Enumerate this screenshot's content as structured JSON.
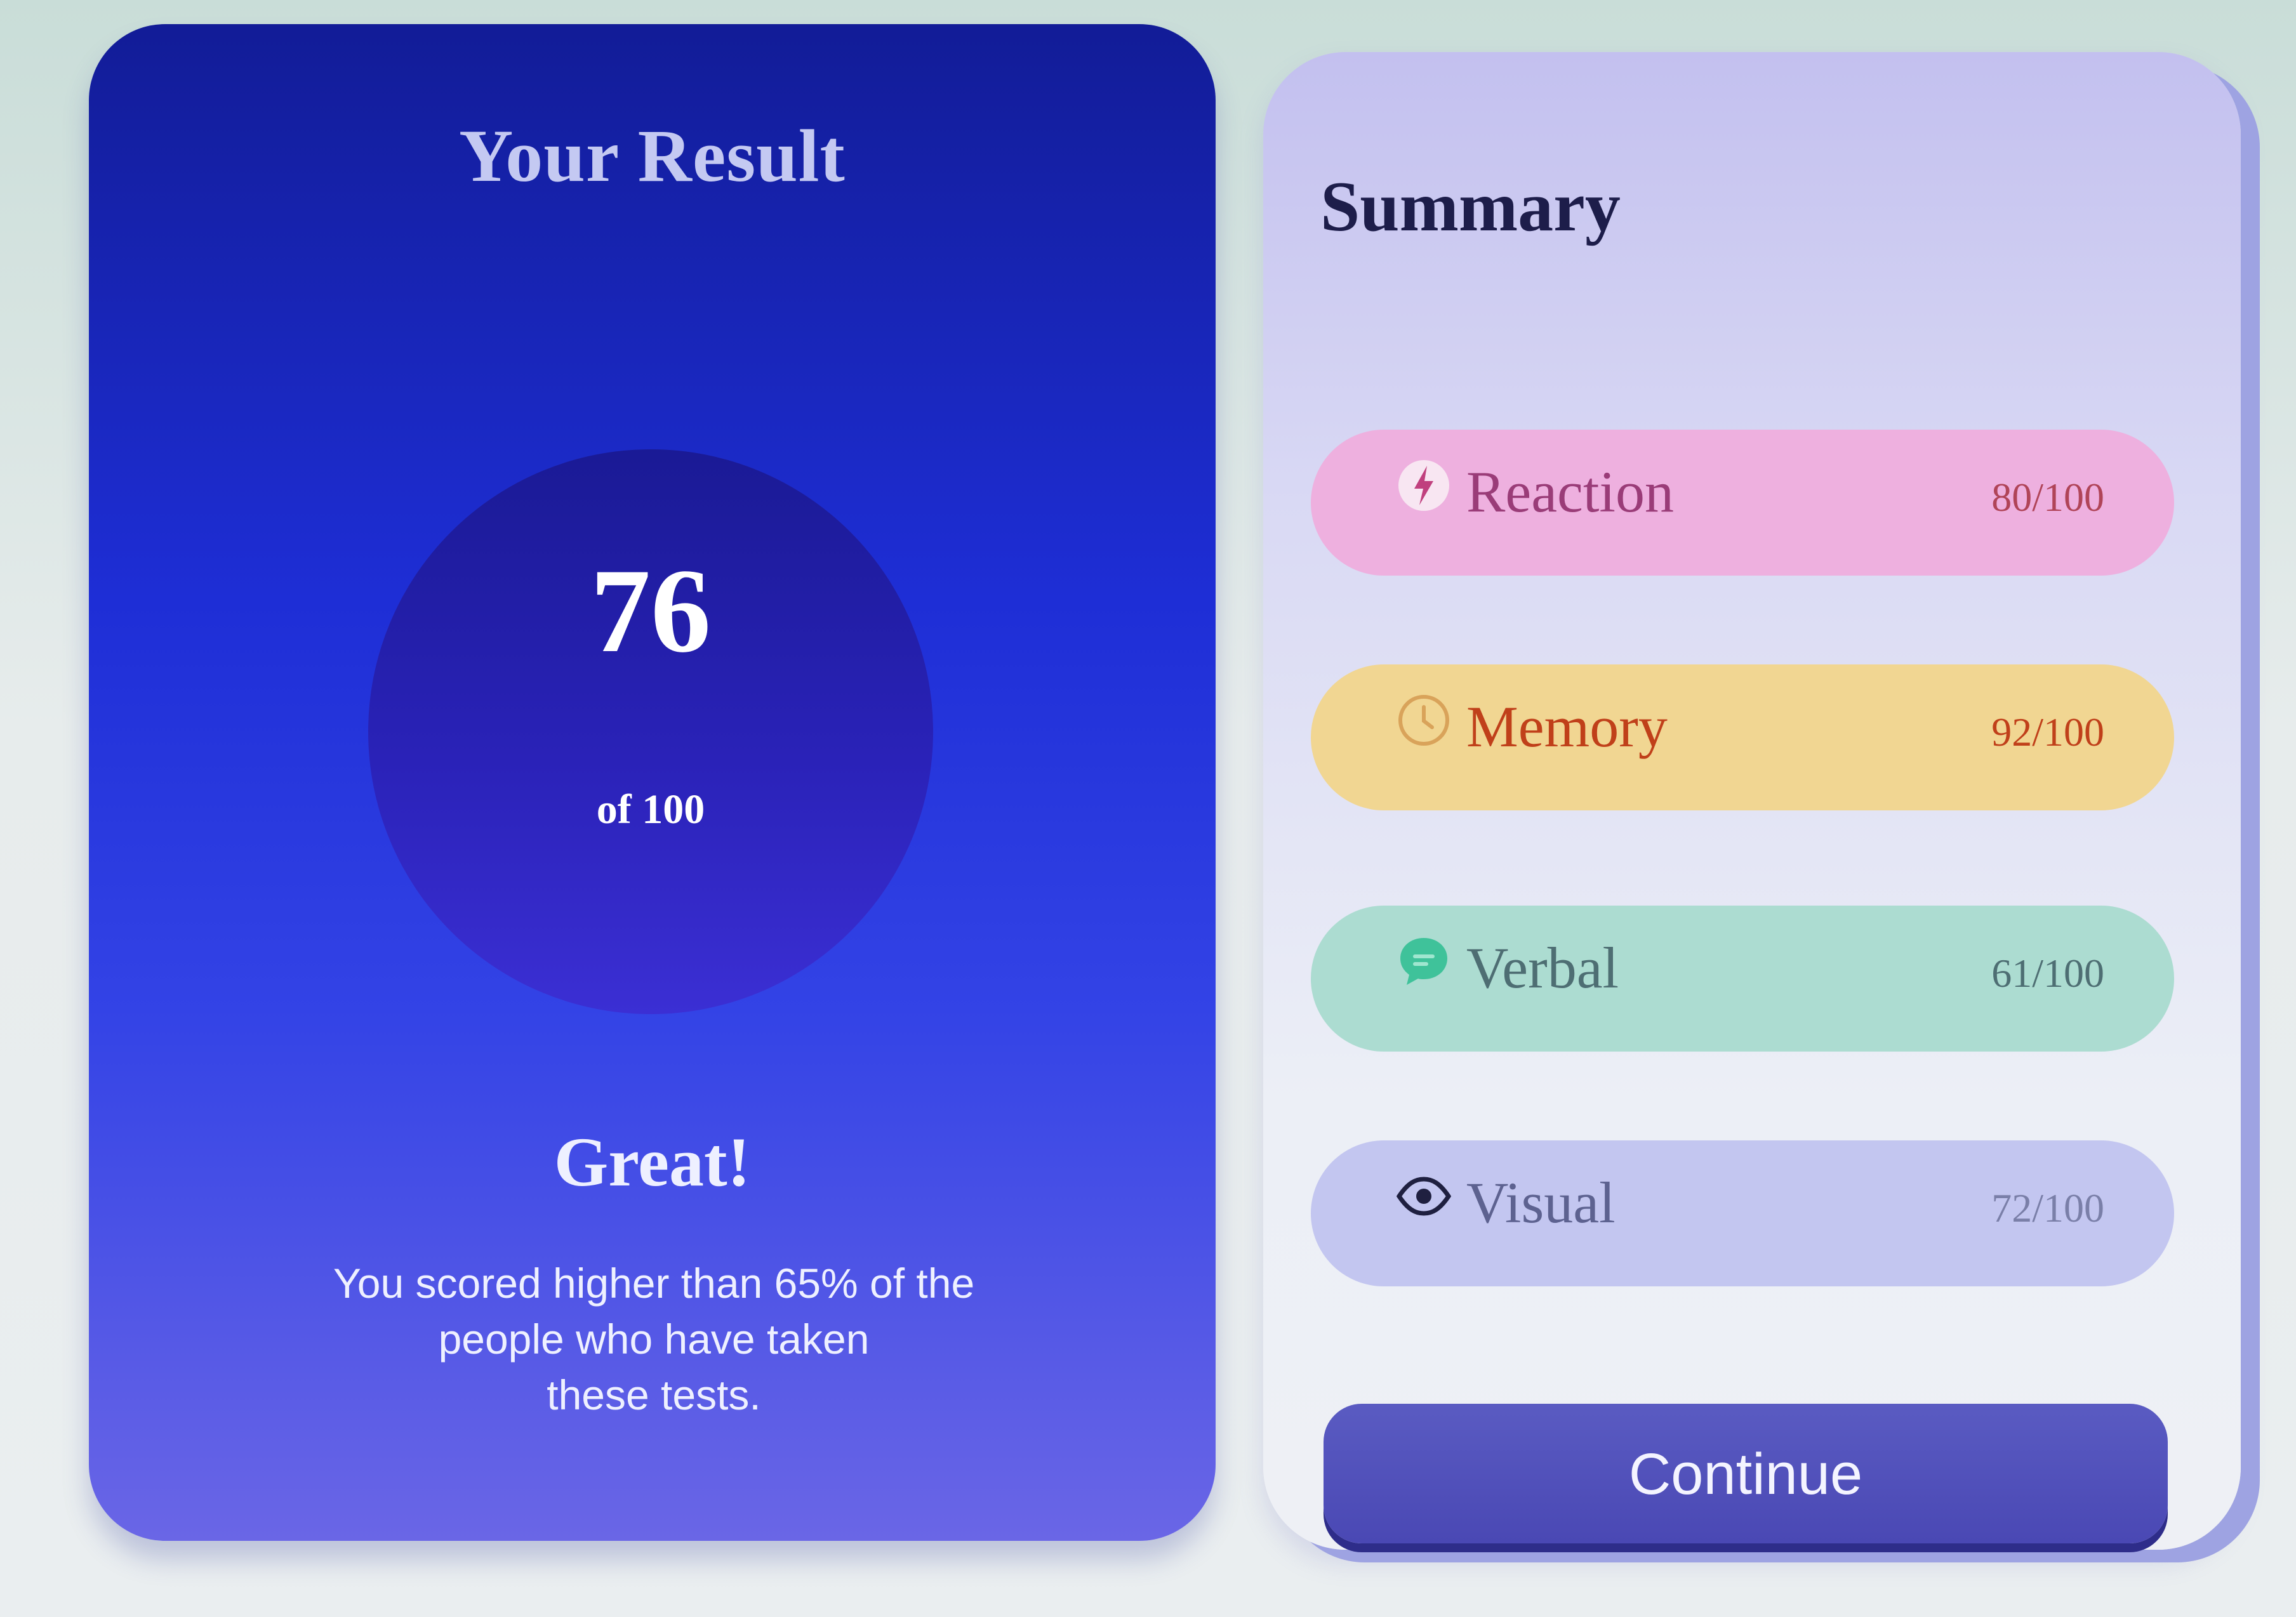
{
  "result": {
    "title": "Your Result",
    "score": "76",
    "score_of": "of 100",
    "verdict": "Great!",
    "description_lines": [
      "You scored higher than 65% of the",
      "people who have taken",
      "these tests."
    ]
  },
  "summary": {
    "title": "Summary",
    "items": [
      {
        "label": "Reaction",
        "score": "80/100",
        "icon": "lightning-icon",
        "color": "#eeb0df"
      },
      {
        "label": "Memory",
        "score": "92/100",
        "icon": "clock-icon",
        "color": "#f1d692"
      },
      {
        "label": "Verbal",
        "score": "61/100",
        "icon": "speech-bubble-icon",
        "color": "#acdcd1"
      },
      {
        "label": "Visual",
        "score": "72/100",
        "icon": "eye-icon",
        "color": "#c3c6f0"
      }
    ],
    "continue_label": "Continue"
  },
  "colors": {
    "result_card_top": "#121c97",
    "result_card_bottom": "#6a66e6",
    "button": "#4a48b4"
  }
}
